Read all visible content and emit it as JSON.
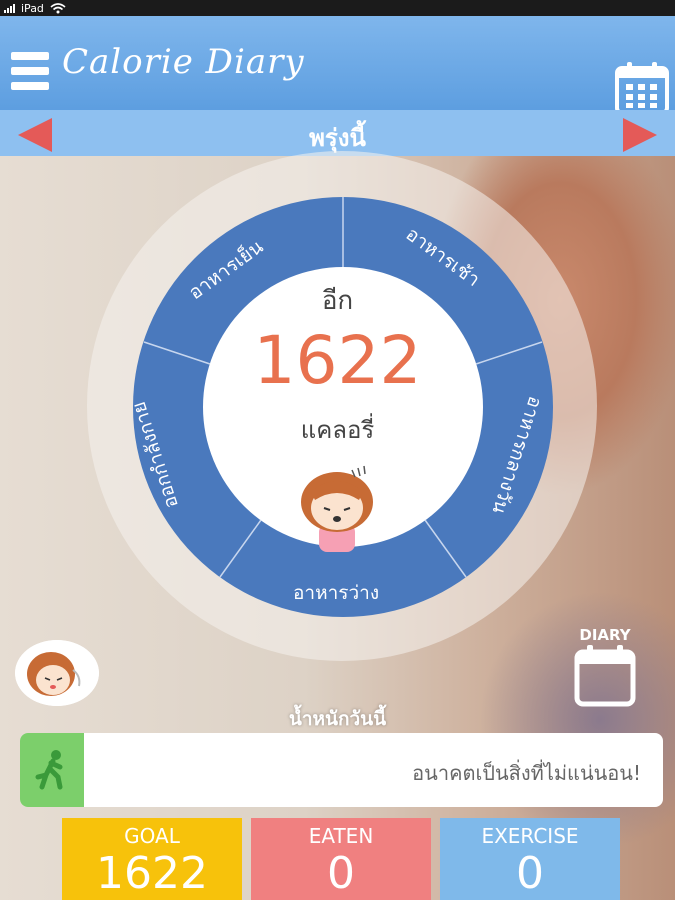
{
  "status_bar": {
    "device": "iPad"
  },
  "header": {
    "app_title": "Calorie Diary",
    "menu_icon": "hamburger-menu-icon",
    "calendar_icon": "calendar-icon"
  },
  "nav": {
    "title": "พรุ่งนี้",
    "prev_icon": "left-arrow-icon",
    "next_icon": "right-arrow-icon",
    "arrow_color": "#e45a58"
  },
  "wheel": {
    "segments": [
      "อาหารเช้า",
      "อาหารเย็น",
      "ออกกำลังกาย",
      "อาหารว่าง",
      "อาหารกลางวัน"
    ],
    "remain_label": "อีก",
    "remain_value": "1622",
    "unit_label": "แคลอรี่",
    "ring_color": "#4a79bd",
    "value_color": "#e8714e"
  },
  "diary_button": {
    "label": "DIARY"
  },
  "weight_label": "น้ำหนักวันนี้",
  "message": {
    "text": "อนาคตเป็นสิ่งที่ไม่แน่นอน!"
  },
  "stats": {
    "goal": {
      "label": "GOAL",
      "value": "1622",
      "color": "#f7c20b"
    },
    "eaten": {
      "label": "EATEN",
      "value": "0",
      "color": "#f08080"
    },
    "exercise": {
      "label": "EXERCISE",
      "value": "0",
      "color": "#7fb9ea"
    }
  }
}
